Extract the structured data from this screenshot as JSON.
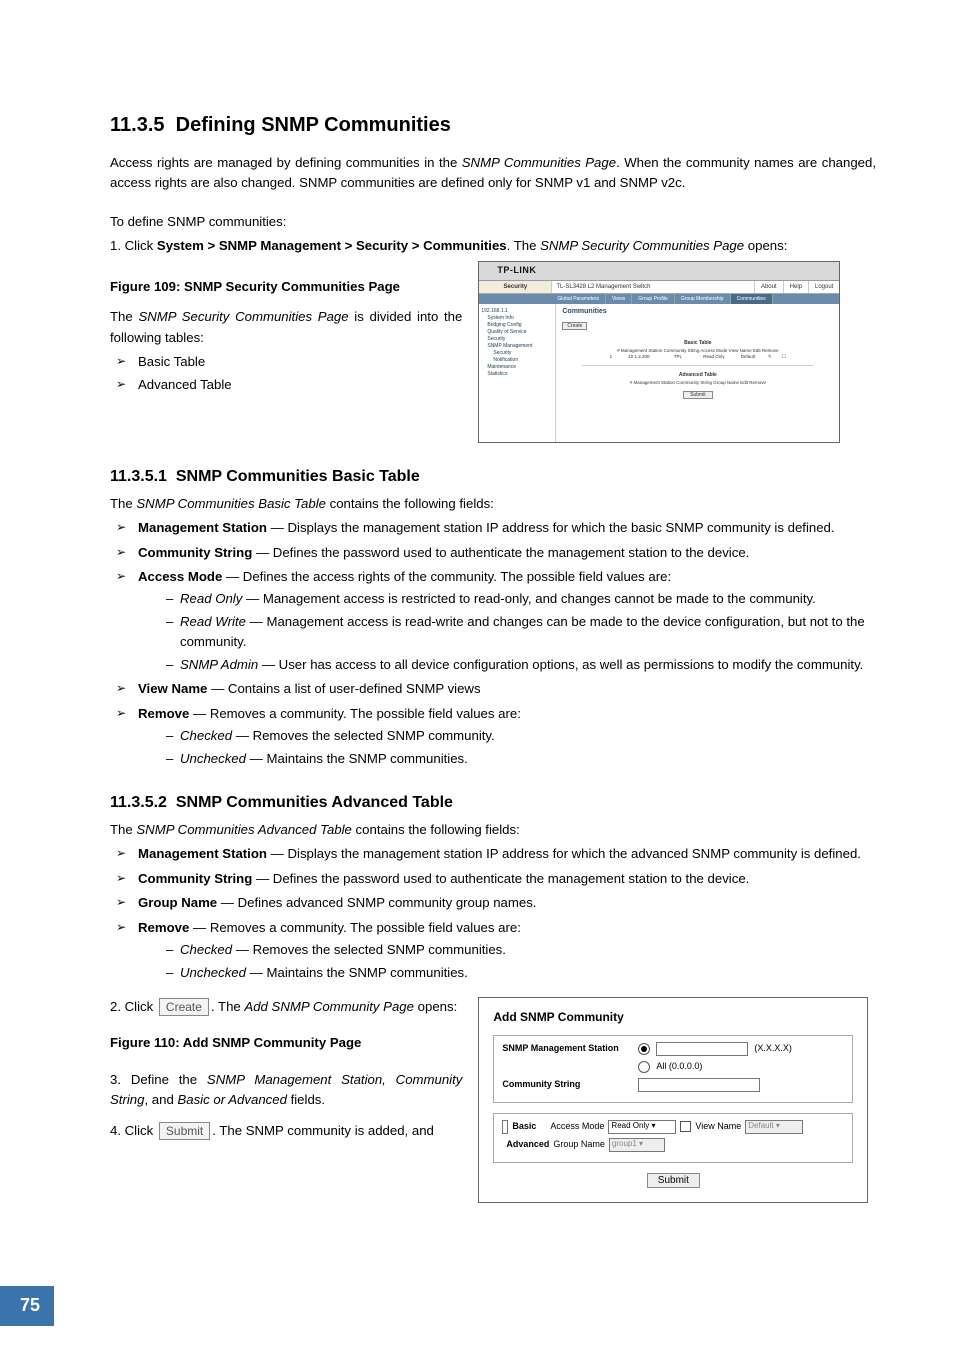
{
  "page_number": "75",
  "section": {
    "num": "11.3.5",
    "title": "Defining SNMP Communities",
    "intro1": "Access rights are managed by defining communities in the ",
    "intro1_em": "SNMP Communities Page",
    "intro1_tail": ". When the community names are changed, access rights are also changed. SNMP communities are defined only for SNMP v1 and SNMP v2c.",
    "intro2": "To define SNMP communities:",
    "step1_pre": "1.  Click ",
    "step1_bold": "System > SNMP Management > Security > Communities",
    "step1_mid": ". The ",
    "step1_em": "SNMP Security Communities Page",
    "step1_tail": " opens:",
    "fig109_caption": "Figure 109: SNMP Security Communities Page",
    "divided_pre": "The ",
    "divided_em": "SNMP Security Communities Page",
    "divided_tail": " is divided into the following tables:",
    "tables": [
      "Basic Table",
      "Advanced Table"
    ]
  },
  "sub1": {
    "num": "11.3.5.1",
    "title": "SNMP Communities Basic Table",
    "lead_pre": "The ",
    "lead_em": "SNMP Communities Basic Table",
    "lead_tail": " contains the following fields:",
    "fields": {
      "ms": {
        "name": "Management Station",
        "desc": " — Displays the management station IP address for which the basic SNMP community is defined."
      },
      "cs": {
        "name": "Community String",
        "desc": " — Defines the password used to authenticate the management station to the device."
      },
      "am": {
        "name": "Access Mode",
        "desc": " — Defines the access rights of the community. The possible field values are:"
      },
      "am_opts": {
        "ro_name": "Read Only",
        "ro_desc": " — Management access is restricted to read-only, and changes cannot be made to the community.",
        "rw_name": "Read Write",
        "rw_desc": " — Management access is read-write and changes can be made to the device configuration, but not to the community.",
        "sa_name": "SNMP Admin",
        "sa_desc": " — User has access to all device configuration options, as well as permissions to modify the community."
      },
      "vn": {
        "name": "View Name",
        "desc": " — Contains a list of user-defined SNMP views"
      },
      "rm": {
        "name": "Remove",
        "desc": " — Removes a community. The possible field values are:"
      },
      "rm_opts": {
        "c_name": "Checked",
        "c_desc": " — Removes the selected SNMP community.",
        "u_name": "Unchecked",
        "u_desc": " — Maintains the SNMP communities."
      }
    }
  },
  "sub2": {
    "num": "11.3.5.2",
    "title": "SNMP Communities Advanced Table",
    "lead_pre": "The ",
    "lead_em": "SNMP Communities Advanced Table",
    "lead_tail": " contains the following fields:",
    "fields": {
      "ms": {
        "name": "Management Station",
        "desc": " — Displays the management station IP address for which the advanced SNMP community is defined."
      },
      "cs": {
        "name": "Community String",
        "desc": " — Defines the password used to authenticate the management station to the device."
      },
      "gn": {
        "name": "Group Name",
        "desc": " — Defines advanced SNMP community group names."
      },
      "rm": {
        "name": "Remove",
        "desc": " — Removes a community. The possible field values are:"
      },
      "rm_opts": {
        "c_name": "Checked",
        "c_desc": " — Removes the selected SNMP communities.",
        "u_name": "Unchecked",
        "u_desc": " — Maintains the SNMP communities."
      }
    }
  },
  "steps": {
    "s2_pre": "2.  Click ",
    "s2_btn": "Create",
    "s2_mid": ". The ",
    "s2_em": "Add SNMP Community Page",
    "s2_tail": " opens:",
    "fig110_caption": "Figure 110: Add SNMP Community Page",
    "s3_pre": "3.   Define the ",
    "s3_em": "SNMP Management Station, Community String",
    "s3_mid": ", and ",
    "s3_em2": "Basic or Advanced",
    "s3_tail": " fields.",
    "s4_pre": "4.  Click ",
    "s4_btn": "Submit",
    "s4_tail": ". The SNMP community is added, and"
  },
  "fig109": {
    "logo": "TP-LINK",
    "security": "Security",
    "device": "TL-SL3428 L2 Management Switch",
    "about": "About",
    "help": "Help",
    "logout": "Logout",
    "tabs": [
      "Global Parameters",
      "Views",
      "Group Profile",
      "Group Membership",
      "Communities"
    ],
    "ip": "192.168.1.1",
    "tree": [
      "System Info",
      "Bridging Config",
      "Quality of Service",
      "Security",
      "SNMP Management",
      "Security",
      "Notification",
      "Maintenance",
      "Statistics"
    ],
    "h": "Communities",
    "create": "Create",
    "basic": "Basic Table",
    "bhead": "# Management Station Community String Access Mode View Name Edit Remove",
    "brow_n": "1",
    "brow_ip": "10.1.2.200",
    "brow_cs": "TPL",
    "brow_am": "Read Only",
    "brow_vn": "Default",
    "brow_ed": "✎",
    "brow_rm": "☐",
    "adv": "Advanced Table",
    "ahead": "# Management Station Community String Group Name Edit Remove",
    "submit": "Submit"
  },
  "fig110": {
    "title": "Add SNMP Community",
    "ms": "SNMP Management Station",
    "mask": "(X.X.X.X)",
    "all": "All (0.0.0.0)",
    "cs": "Community String",
    "basic": "Basic",
    "am": "Access Mode",
    "am_val": "Read Only",
    "vn": "View Name",
    "vn_val": "Default",
    "adv": "Advanced",
    "gn": "Group Name",
    "gn_val": "group1",
    "submit": "Submit"
  }
}
